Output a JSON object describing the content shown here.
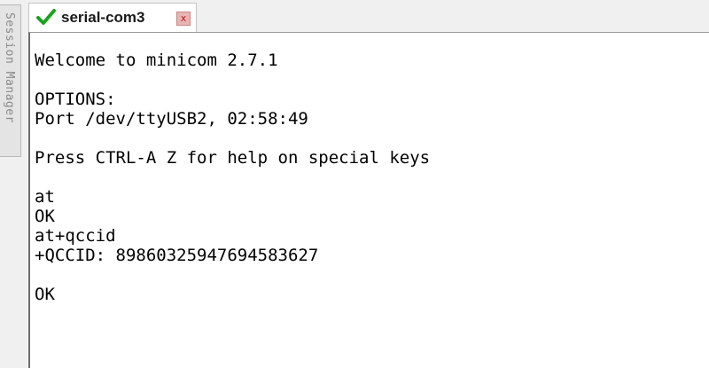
{
  "session_manager": {
    "label": "Session Manager"
  },
  "tabs": [
    {
      "title": "serial-com3",
      "status_icon": "check-icon",
      "status_color": "#1aa31a",
      "close_label": "x"
    }
  ],
  "terminal": {
    "lines": [
      "",
      "Welcome to minicom 2.7.1",
      "",
      "OPTIONS:",
      "Port /dev/ttyUSB2, 02:58:49",
      "",
      "Press CTRL-A Z for help on special keys",
      "",
      "at",
      "OK",
      "at+qccid",
      "+QCCID: 89860325947694583627",
      "",
      "OK"
    ]
  },
  "colors": {
    "terminal_bg": "#ffffff",
    "terminal_fg": "#000000",
    "tab_close": "#c02020"
  }
}
